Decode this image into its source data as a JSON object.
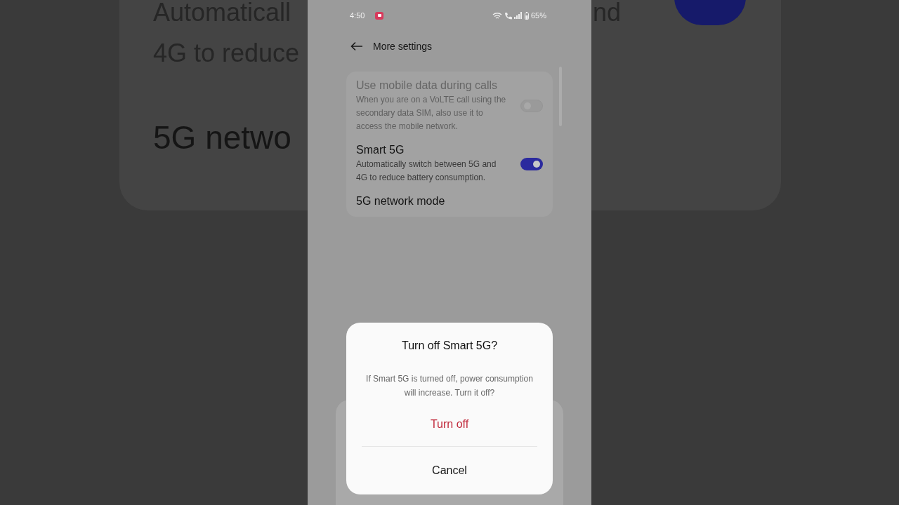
{
  "backdrop": {
    "left_lines": [
      "Automaticall",
      "4G to reduce",
      "5G netwo"
    ],
    "right_lines": [
      "nd"
    ]
  },
  "status_bar": {
    "time": "4:50",
    "battery": "65%"
  },
  "header": {
    "title": "More settings"
  },
  "settings": [
    {
      "kind": "toggle",
      "title": "Use mobile data during calls",
      "description": "When you are on a VoLTE call using the secondary data SIM, also use it to access the mobile network.",
      "on": false,
      "disabled": true
    },
    {
      "kind": "toggle",
      "title": "Smart 5G",
      "description": "Automatically switch between 5G and 4G to reduce battery consumption.",
      "on": true,
      "disabled": false
    },
    {
      "kind": "link",
      "title": "5G network mode",
      "disabled": false
    }
  ],
  "dialog": {
    "title": "Turn off Smart 5G?",
    "message": "If Smart 5G is turned off, power consumption will increase. Turn it off?",
    "buttons": [
      {
        "label": "Turn off",
        "kind": "destructive"
      },
      {
        "label": "Cancel",
        "kind": "normal"
      }
    ]
  }
}
